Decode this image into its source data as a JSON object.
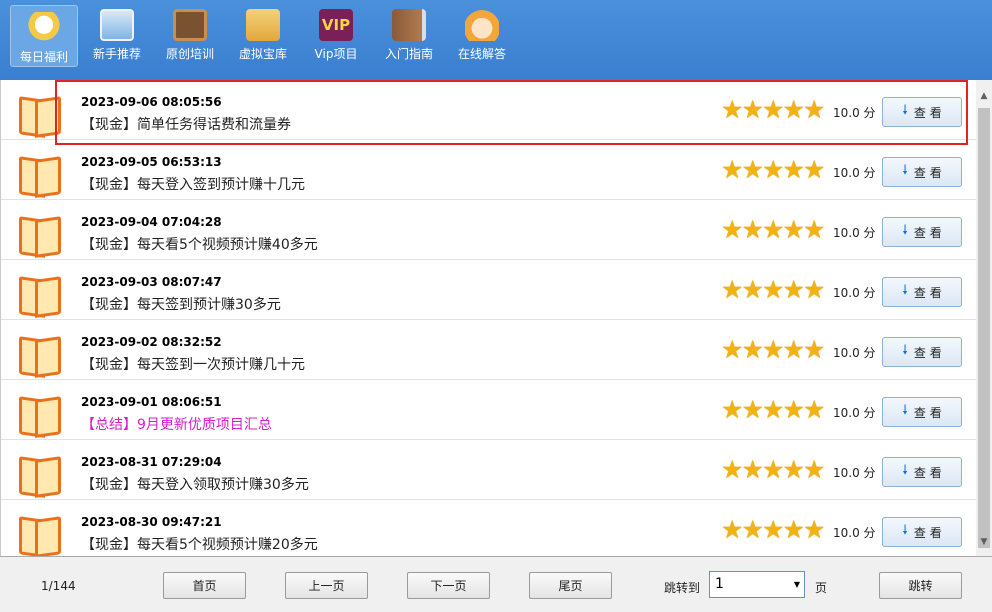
{
  "toolbar": {
    "items": [
      {
        "label": "每日福利",
        "icon": "lucky-cat-icon"
      },
      {
        "label": "新手推荐",
        "icon": "computer-icon"
      },
      {
        "label": "原创培训",
        "icon": "blackboard-icon"
      },
      {
        "label": "虚拟宝库",
        "icon": "treasure-store-icon"
      },
      {
        "label": "Vip项目",
        "icon": "vip-icon",
        "icon_text": "VIP"
      },
      {
        "label": "入门指南",
        "icon": "guide-book-icon"
      },
      {
        "label": "在线解答",
        "icon": "support-agent-icon"
      }
    ]
  },
  "list": {
    "rows": [
      {
        "date": "2023-09-06 08:05:56",
        "title": "【现金】简单任务得话费和流量券",
        "score": "10.0 分",
        "view": "查 看"
      },
      {
        "date": "2023-09-05 06:53:13",
        "title": "【现金】每天登入签到预计赚十几元",
        "score": "10.0 分",
        "view": "查 看"
      },
      {
        "date": "2023-09-04 07:04:28",
        "title": "【现金】每天看5个视频预计赚40多元",
        "score": "10.0 分",
        "view": "查 看"
      },
      {
        "date": "2023-09-03 08:07:47",
        "title": "【现金】每天签到预计赚30多元",
        "score": "10.0 分",
        "view": "查 看"
      },
      {
        "date": "2023-09-02 08:32:52",
        "title": "【现金】每天签到一次预计赚几十元",
        "score": "10.0 分",
        "view": "查 看"
      },
      {
        "date": "2023-09-01 08:06:51",
        "title": "【总结】9月更新优质项目汇总",
        "score": "10.0 分",
        "view": "查 看"
      },
      {
        "date": "2023-08-31 07:29:04",
        "title": "【现金】每天登入领取预计赚30多元",
        "score": "10.0 分",
        "view": "查 看"
      },
      {
        "date": "2023-08-30 09:47:21",
        "title": "【现金】每天看5个视频预计赚20多元",
        "score": "10.0 分",
        "view": "查 看"
      }
    ],
    "rating_stars": 5
  },
  "colors": {
    "toolbar": "#3a7fd0",
    "star": "#f2b311",
    "highlight_border": "#e02424",
    "summary_title": "#d81ccb"
  },
  "footer": {
    "page_info": "1/144",
    "first": "首页",
    "prev": "上一页",
    "next": "下一页",
    "last": "尾页",
    "jump_label": "跳转到",
    "jump_value": "1",
    "page_unit": "页",
    "jump_button": "跳转"
  }
}
